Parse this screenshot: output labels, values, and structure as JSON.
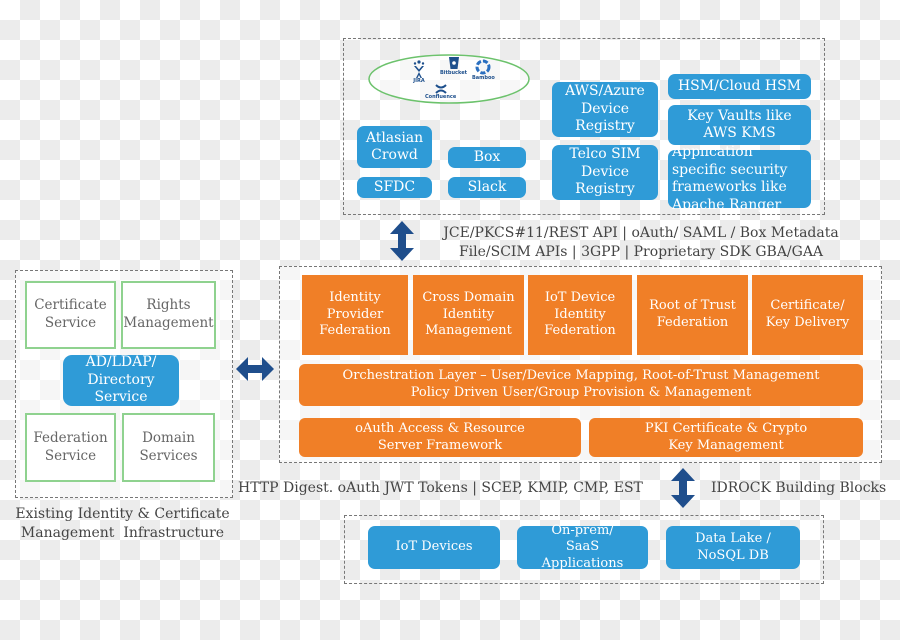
{
  "top_panel": {
    "logos": [
      {
        "name": "JIRA",
        "icon": "jira-icon"
      },
      {
        "name": "Bitbucket",
        "icon": "bitbucket-icon"
      },
      {
        "name": "Bamboo",
        "icon": "bamboo-icon"
      },
      {
        "name": "Confluence",
        "icon": "confluence-icon"
      }
    ],
    "boxes": {
      "atlasian_crowd": "Atlasian Crowd",
      "box": "Box",
      "sfdc": "SFDC",
      "slack": "Slack",
      "aws_azure": "AWS/Azure Device Registry",
      "telco_sim": "Telco SIM Device Registry",
      "hsm": "HSM/Cloud HSM",
      "key_vaults": "Key Vaults like AWS KMS",
      "app_security": "Application specific security frameworks like Apache Ranger"
    }
  },
  "top_protocols": {
    "line1": "JCE/PKCS#11/REST API | oAuth/ SAML / Box Metadata",
    "line2": "File/SCIM APIs | 3GPP | Proprietary SDK GBA/GAA"
  },
  "left_panel": {
    "certificate_service": "Certificate Service",
    "rights_management": "Rights Management",
    "ad_ldap": "AD/LDAP/ Directory Service",
    "federation_service": "Federation Service",
    "domain_services": "Domain Services",
    "caption_line1": "Existing Identity & Certificate",
    "caption_line2": "Management  Infrastructure"
  },
  "idrock": {
    "blocks": [
      "Identity Provider Federation",
      "Cross Domain Identity Management",
      "IoT Device Identity Federation",
      "Root of Trust Federation",
      "Certificate/ Key Delivery"
    ],
    "orchestration_line1": "Orchestration Layer – User/Device Mapping, Root-of-Trust Management",
    "orchestration_line2": "Policy Driven User/Group Provision & Management",
    "oauth_framework": "oAuth Access & Resource Server Framework",
    "pki_management": "PKI Certificate & Crypto Key Management",
    "caption": "IDROCK Building Blocks"
  },
  "bottom_protocols": "HTTP Digest. oAuth JWT Tokens | SCEP, KMIP, CMP, EST",
  "bottom_panel": {
    "iot_devices": "IoT Devices",
    "onprem_saas": "On-prem/ SaaS Applications",
    "data_lake": "Data Lake / NoSQL DB"
  },
  "colors": {
    "blue": "#2f9bd7",
    "orange": "#f07f27",
    "arrow": "#1f4e8c",
    "green_border": "#8fd28f"
  }
}
